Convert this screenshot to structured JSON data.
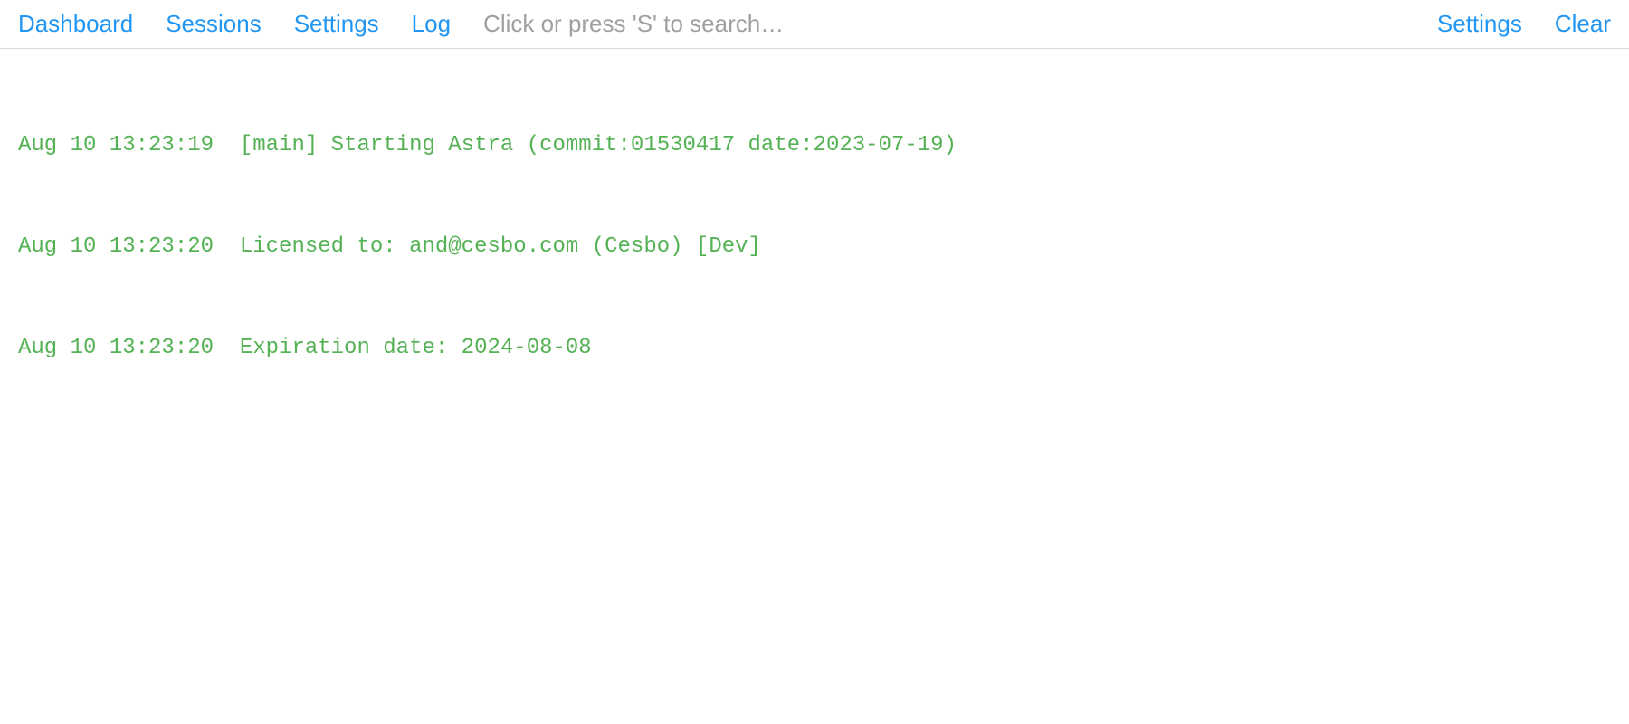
{
  "nav": {
    "left": [
      {
        "label": "Dashboard",
        "name": "nav-dashboard"
      },
      {
        "label": "Sessions",
        "name": "nav-sessions"
      },
      {
        "label": "Settings",
        "name": "nav-settings"
      },
      {
        "label": "Log",
        "name": "nav-log"
      }
    ],
    "right": [
      {
        "label": "Settings",
        "name": "nav-settings-right"
      },
      {
        "label": "Clear",
        "name": "nav-clear"
      }
    ]
  },
  "search": {
    "placeholder": "Click or press 'S' to search…",
    "value": ""
  },
  "log": {
    "lines": [
      "Aug 10 13:23:19  [main] Starting Astra (commit:01530417 date:2023-07-19)",
      "Aug 10 13:23:20  Licensed to: and@cesbo.com (Cesbo) [Dev]",
      "Aug 10 13:23:20  Expiration date: 2024-08-08"
    ]
  }
}
